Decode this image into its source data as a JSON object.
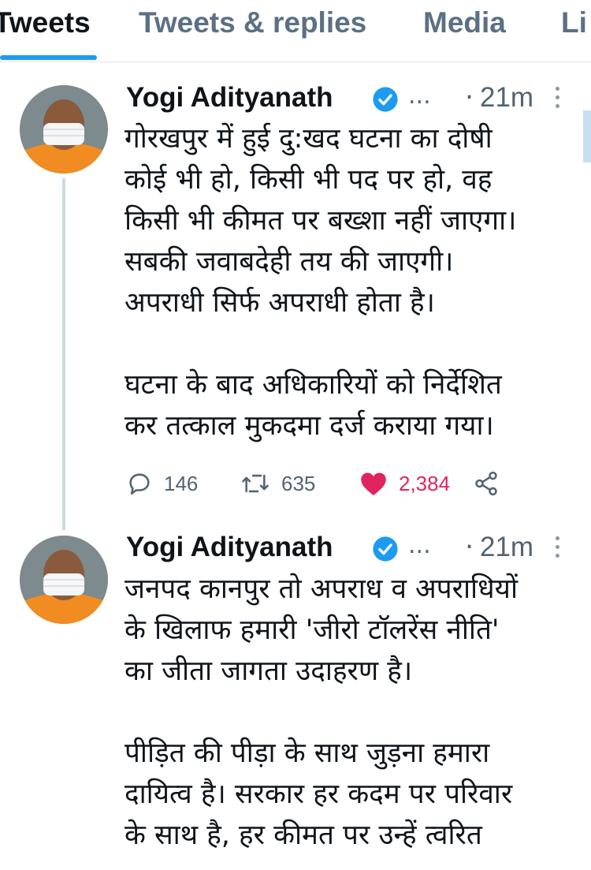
{
  "tabs": [
    {
      "label": "Tweets",
      "active": true
    },
    {
      "label": "Tweets & replies",
      "active": false
    },
    {
      "label": "Media",
      "active": false
    },
    {
      "label": "Li",
      "active": false
    }
  ],
  "colors": {
    "accent": "#1d9bf0",
    "like": "#e0245e",
    "secondary_text": "#536471"
  },
  "tweets": [
    {
      "author": "Yogi Adityanath",
      "verified": true,
      "ellipsis": "...",
      "time": "21m",
      "lines": [
        "गोरखपुर में हुई दु:खद घटना का दोषी",
        "कोई भी हो, किसी भी पद पर हो, वह",
        "किसी भी कीमत पर बख्शा नहीं जाएगा।",
        "सबकी जवाबदेही तय की जाएगी।",
        "अपराधी सिर्फ अपराधी होता है।",
        "",
        "घटना के बाद अधिकारियों को निर्देशित",
        "कर तत्काल मुकदमा दर्ज कराया गया।"
      ],
      "replies": "146",
      "retweets": "635",
      "likes": "2,384",
      "liked": true
    },
    {
      "author": "Yogi Adityanath",
      "verified": true,
      "ellipsis": "...",
      "time": "21m",
      "lines": [
        "जनपद कानपुर तो अपराध व अपराधियों",
        "के खिलाफ हमारी 'जीरो टॉलरेंस नीति'",
        "का जीता जागता उदाहरण है।",
        "",
        "पीड़ित की पीड़ा के साथ जुड़ना हमारा",
        "दायित्व है। सरकार हर कदम पर परिवार",
        "के साथ है, हर कीमत पर उन्हें त्वरित"
      ]
    }
  ]
}
